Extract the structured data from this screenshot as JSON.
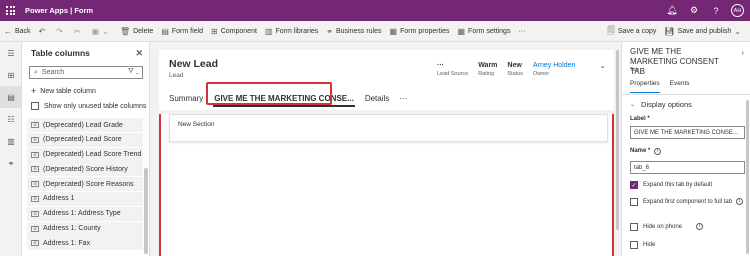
{
  "topbar": {
    "app_title": "Power Apps  |  Form",
    "avatar_initials": "AH",
    "brand_color": "#742774"
  },
  "commandbar": {
    "back": "Back",
    "delete": "Delete",
    "form_field": "Form field",
    "component": "Component",
    "form_libraries": "Form libraries",
    "business_rules": "Business rules",
    "form_properties": "Form properties",
    "form_settings": "Form settings",
    "more": "···",
    "save_a_copy": "Save a copy",
    "save_and_publish": "Save and publish"
  },
  "table_columns": {
    "title": "Table columns",
    "search_placeholder": "Search",
    "new_table_column": "New table column",
    "show_unused": "Show only unused table columns",
    "items": [
      "(Deprecated) Lead Grade",
      "(Deprecated) Lead Score",
      "(Deprecated) Lead Score Trend",
      "(Deprecated) Score History",
      "(Deprecated) Score Reasons",
      "Address 1",
      "Address 1: Address Type",
      "Address 1: County",
      "Address 1: Fax"
    ]
  },
  "form": {
    "title": "New Lead",
    "entity": "Lead",
    "header_fields": [
      {
        "value": "···",
        "label": "Lead Source"
      },
      {
        "value": "Warm",
        "label": "Rating"
      },
      {
        "value": "New",
        "label": "Status"
      },
      {
        "value": "Arney Holden",
        "label": "Owner"
      }
    ],
    "tabs": [
      "Summary",
      "GIVE ME THE MARKETING CONSE...",
      "Details",
      "···"
    ],
    "selected_tab": 1,
    "section_title": "New Section",
    "highlight_color": "#d13438"
  },
  "properties": {
    "title": "GIVE ME THE MARKETING CONSENT TAB",
    "subtitle": "Tab",
    "tabs": [
      "Properties",
      "Events"
    ],
    "section": "Display options",
    "label_caption": "Label *",
    "label_value": "GIVE ME THE MARKETING CONSE...",
    "name_caption": "Name *",
    "name_value": "tab_6",
    "checks": [
      {
        "text": "Expand this tab by default",
        "checked": true
      },
      {
        "text": "Expand first component to full tab",
        "checked": false
      },
      {
        "text": "Hide on phone",
        "checked": false
      },
      {
        "text": "Hide",
        "checked": false
      }
    ]
  }
}
